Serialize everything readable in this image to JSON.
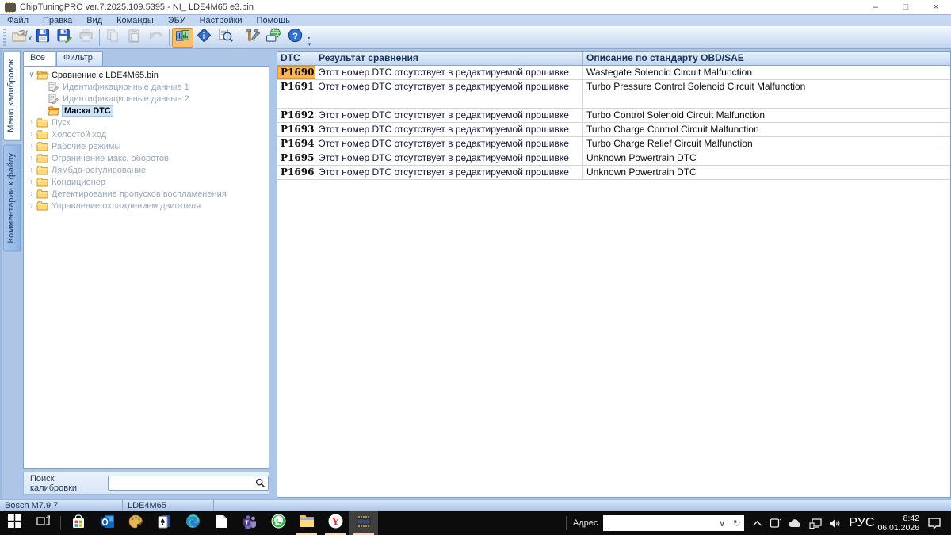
{
  "window": {
    "title": "ChipTuningPRO ver.7.2025.109.5395 - NI_ LDE4M65 e3.bin",
    "controls": {
      "minimize": "–",
      "maximize": "□",
      "close": "×"
    }
  },
  "menu": {
    "items": [
      "Файл",
      "Правка",
      "Вид",
      "Команды",
      "ЭБУ",
      "Настройки",
      "Помощь"
    ]
  },
  "toolbar": {
    "buttons": [
      {
        "name": "open",
        "enabled": true,
        "dropdown": true
      },
      {
        "name": "save",
        "enabled": true
      },
      {
        "name": "save-as",
        "enabled": true
      },
      {
        "name": "print",
        "enabled": false
      },
      {
        "name": "sep"
      },
      {
        "name": "copy",
        "enabled": false
      },
      {
        "name": "paste",
        "enabled": false
      },
      {
        "name": "undo",
        "enabled": false
      },
      {
        "name": "sep"
      },
      {
        "name": "compare",
        "enabled": true,
        "active": true
      },
      {
        "name": "info",
        "enabled": true
      },
      {
        "name": "preview",
        "enabled": true
      },
      {
        "name": "sep"
      },
      {
        "name": "tools",
        "enabled": true
      },
      {
        "name": "web",
        "enabled": true
      },
      {
        "name": "help",
        "enabled": true
      }
    ]
  },
  "side_tabs": {
    "items": [
      {
        "label": "Меню калибровок",
        "active": true
      },
      {
        "label": "Комментарии к файлу",
        "active": false
      }
    ]
  },
  "tree": {
    "tabs": [
      {
        "label": "Все",
        "active": true
      },
      {
        "label": "Фильтр",
        "active": false
      }
    ],
    "nodes": [
      {
        "label": "Сравнение с LDE4M65.bin",
        "level": 0,
        "icon": "folder-open",
        "expanded": true,
        "muted": false,
        "selected": false
      },
      {
        "label": "Идентификационные данные 1",
        "level": 1,
        "icon": "doc-edit",
        "muted": true,
        "selected": false
      },
      {
        "label": "Идентификационные данные 2",
        "level": 1,
        "icon": "doc-edit",
        "muted": true,
        "selected": false
      },
      {
        "label": "Маска DTC",
        "level": 1,
        "icon": "mask",
        "muted": false,
        "selected": true
      },
      {
        "label": "Пуск",
        "level": 0,
        "icon": "folder",
        "collapsed": true,
        "muted": true,
        "selected": false
      },
      {
        "label": "Холостой ход",
        "level": 0,
        "icon": "folder",
        "collapsed": true,
        "muted": true,
        "selected": false
      },
      {
        "label": "Рабочие режимы",
        "level": 0,
        "icon": "folder",
        "collapsed": true,
        "muted": true,
        "selected": false
      },
      {
        "label": "Ограничение макс. оборотов",
        "level": 0,
        "icon": "folder",
        "collapsed": true,
        "muted": true,
        "selected": false
      },
      {
        "label": "Лямбда-регулирование",
        "level": 0,
        "icon": "folder",
        "collapsed": true,
        "muted": true,
        "selected": false
      },
      {
        "label": "Кондиционер",
        "level": 0,
        "icon": "folder",
        "collapsed": true,
        "muted": true,
        "selected": false
      },
      {
        "label": "Детектирование пропусков воспламенения",
        "level": 0,
        "icon": "folder",
        "collapsed": true,
        "muted": true,
        "selected": false
      },
      {
        "label": "Управление охлаждением двигателя",
        "level": 0,
        "icon": "folder",
        "collapsed": true,
        "muted": true,
        "selected": false
      }
    ],
    "search_label": "Поиск калибровки",
    "search_value": ""
  },
  "table": {
    "columns": [
      {
        "label": "DTC"
      },
      {
        "label": "Результат сравнения"
      },
      {
        "label": "Описание по стандарту OBD/SAE"
      }
    ],
    "rows": [
      {
        "dtc": "P1690",
        "result": "Этот номер DTC отсутствует в редактируемой прошивке",
        "desc": "Wastegate Solenoid Circuit Malfunction",
        "selected": true,
        "tall": false
      },
      {
        "dtc": "P1691",
        "result": "Этот номер DTC отсутствует в редактируемой прошивке",
        "desc": "Turbo Pressure Control Solenoid Circuit Malfunction",
        "selected": false,
        "tall": true
      },
      {
        "dtc": "P1692",
        "result": "Этот номер DTC отсутствует в редактируемой прошивке",
        "desc": "Turbo Control Solenoid Circuit Malfunction",
        "selected": false,
        "tall": false
      },
      {
        "dtc": "P1693",
        "result": "Этот номер DTC отсутствует в редактируемой прошивке",
        "desc": "Turbo Charge Control Circuit Malfunction",
        "selected": false,
        "tall": false
      },
      {
        "dtc": "P1694",
        "result": "Этот номер DTC отсутствует в редактируемой прошивке",
        "desc": "Turbo Charge Relief Circuit Malfunction",
        "selected": false,
        "tall": false
      },
      {
        "dtc": "P1695",
        "result": "Этот номер DTC отсутствует в редактируемой прошивке",
        "desc": "Unknown Powertrain DTC",
        "selected": false,
        "tall": false
      },
      {
        "dtc": "P1696",
        "result": "Этот номер DTC отсутствует в редактируемой прошивке",
        "desc": "Unknown Powertrain DTC",
        "selected": false,
        "tall": false
      }
    ]
  },
  "status": {
    "segments": [
      "Bosch M7.9.7",
      "LDE4M65",
      ""
    ]
  },
  "taskbar": {
    "apps": [
      {
        "id": "start"
      },
      {
        "id": "task-view"
      },
      {
        "id": "sep"
      },
      {
        "id": "store"
      },
      {
        "id": "outlook"
      },
      {
        "id": "paint"
      },
      {
        "id": "solitaire"
      },
      {
        "id": "edge"
      },
      {
        "id": "notepad"
      },
      {
        "id": "teams"
      },
      {
        "id": "whatsapp"
      },
      {
        "id": "explorer",
        "running": true
      },
      {
        "id": "yandex",
        "running": true
      },
      {
        "id": "chiptuning",
        "running": true,
        "active": true
      }
    ],
    "address_label": "Адрес",
    "address_value": "",
    "tray_icons": [
      "chevron-up",
      "tablet",
      "cloud",
      "network",
      "speaker"
    ],
    "language": "РУС",
    "time": "8:42",
    "date": "06.01.2026"
  },
  "colors": {
    "selected_dtc_bg": "#fbb450",
    "selected_dtc_border": "#e5941f",
    "tree_selection_bg": "#c9e3f8",
    "toolbar_active_bg": "#fbbf6e",
    "header_text": "#16365c",
    "taskbar_bg": "#0c0c0c",
    "running_indicator": "#ffd2ae"
  }
}
